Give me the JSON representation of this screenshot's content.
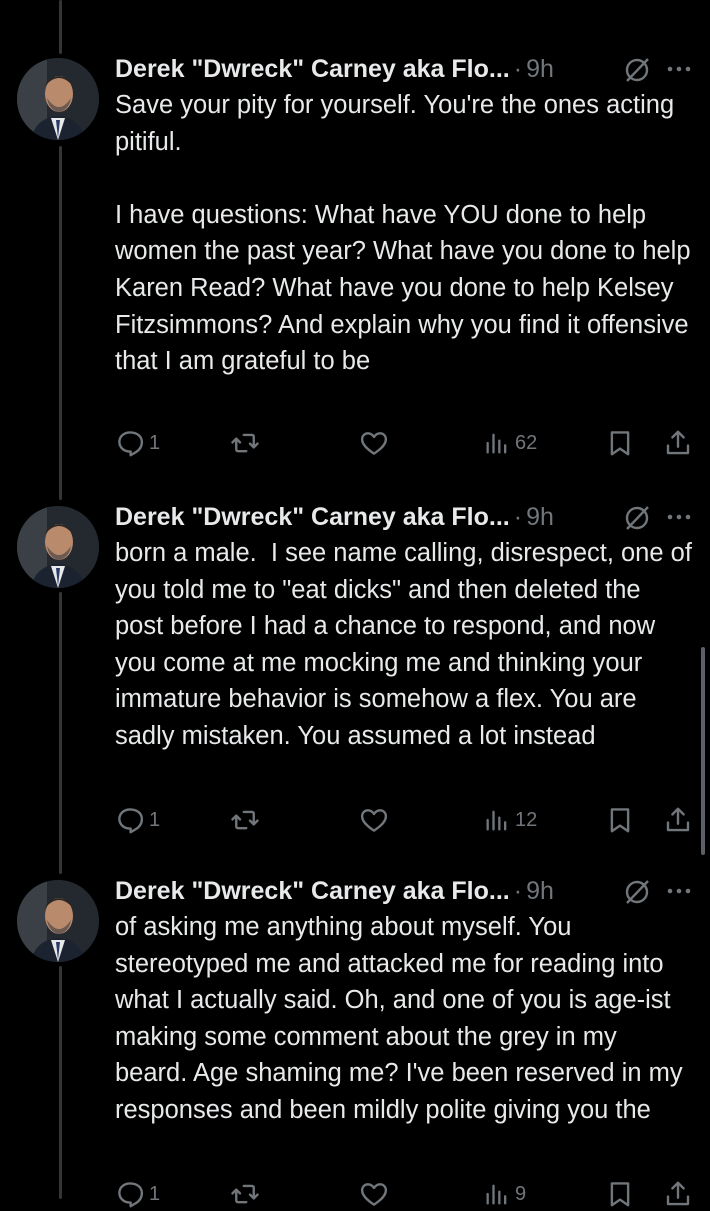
{
  "tweets": [
    {
      "author": "Derek \"Dwreck\" Carney aka Flo...",
      "separator": "·",
      "time": "9h",
      "text": "Save your pity for yourself. You're the ones acting pitiful.\n\nI have questions: What have YOU done to help women the past year? What have you done to help Karen Read? What have you done to help Kelsey Fitzsimmons? And explain why you find it offensive that I am grateful to be",
      "replies": "1",
      "views": "62"
    },
    {
      "author": "Derek \"Dwreck\" Carney aka Flo...",
      "separator": "·",
      "time": "9h",
      "text": "born a male.  I see name calling, disrespect, one of you told me to \"eat dicks\" and then deleted the post before I had a chance to respond, and now you come at me mocking me and thinking your immature behavior is somehow a flex. You are sadly mistaken. You assumed a lot instead",
      "replies": "1",
      "views": "12"
    },
    {
      "author": "Derek \"Dwreck\" Carney aka Flo...",
      "separator": "·",
      "time": "9h",
      "text": "of asking me anything about myself. You stereotyped me and attacked me for reading into what I actually said. Oh, and one of you is age-ist making some comment about the grey in my beard. Age shaming me? I've been reserved in my responses and been mildly polite giving you the",
      "replies": "1",
      "views": "9"
    }
  ],
  "icons": {
    "reply": "reply-icon",
    "repost": "repost-icon",
    "like": "heart-icon",
    "views": "views-icon",
    "bookmark": "bookmark-icon",
    "share": "share-icon",
    "grok": "grok-icon",
    "more": "more-icon"
  },
  "colors": {
    "background": "#000000",
    "text": "#e7e9ea",
    "muted": "#71767b",
    "thread_line": "#333639"
  }
}
